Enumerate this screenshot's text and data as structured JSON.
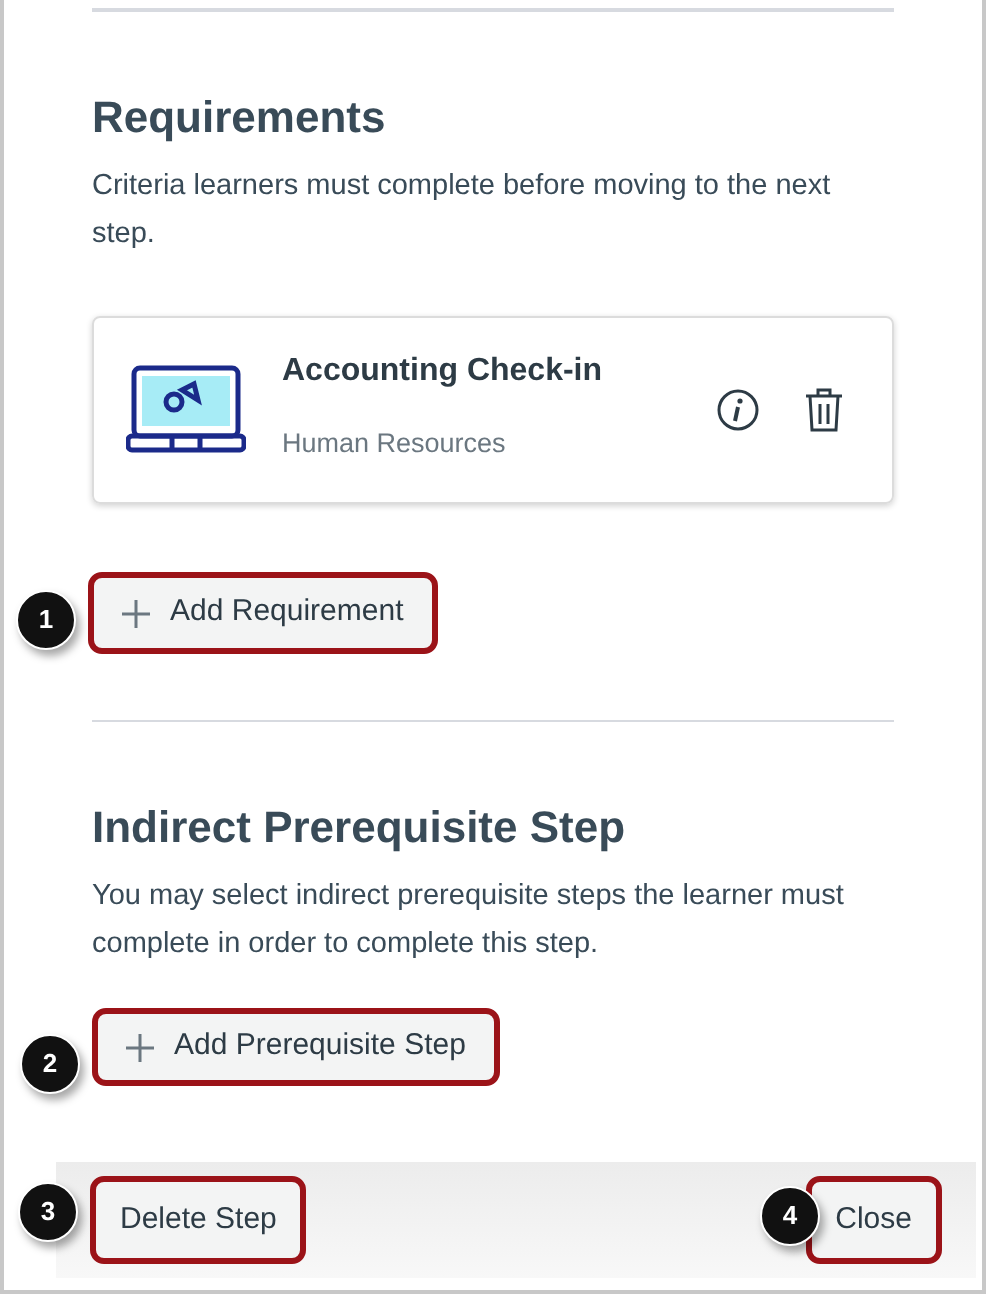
{
  "requirements": {
    "title": "Requirements",
    "description": "Criteria learners must complete before moving to the next step.",
    "items": [
      {
        "title": "Accounting Check-in",
        "subtitle": "Human Resources"
      }
    ],
    "add_button": {
      "label": "Add Requirement",
      "callout": "1"
    }
  },
  "prerequisites": {
    "title": "Indirect Prerequisite Step",
    "description": "You may select indirect prerequisite steps the learner must complete in order to complete this step.",
    "add_button": {
      "label": "Add Prerequisite Step",
      "callout": "2"
    }
  },
  "footer": {
    "delete_button": {
      "label": "Delete Step",
      "callout": "3"
    },
    "close_button": {
      "label": "Close",
      "callout": "4"
    }
  }
}
